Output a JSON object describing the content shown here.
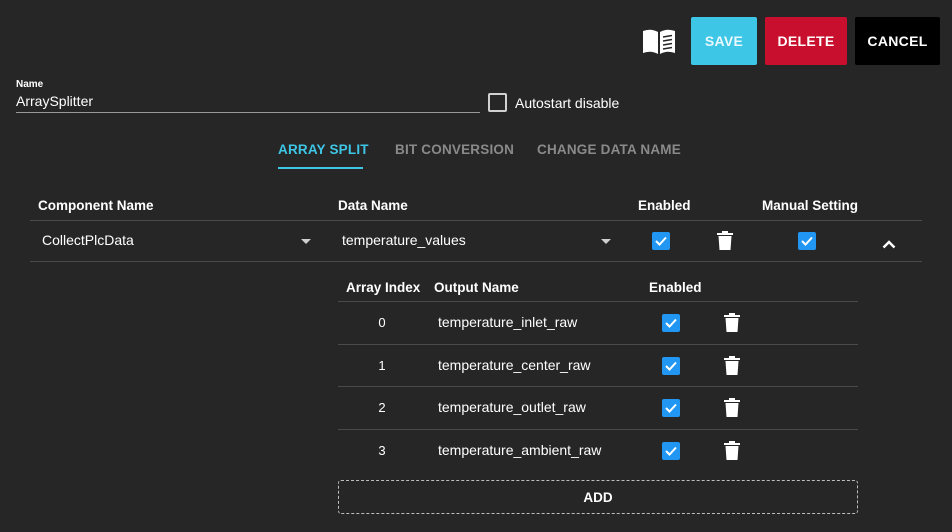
{
  "toolbar": {
    "manual_icon": "book-open-icon",
    "save_label": "SAVE",
    "delete_label": "DELETE",
    "cancel_label": "CANCEL",
    "colors": {
      "save": "#3ec6e6",
      "delete": "#c8102e",
      "cancel": "#000000"
    }
  },
  "name_field": {
    "label": "Name",
    "value": "ArraySplitter"
  },
  "autostart": {
    "label": "Autostart disable",
    "checked": false
  },
  "tabs": [
    {
      "label": "ARRAY SPLIT",
      "active": true
    },
    {
      "label": "BIT CONVERSION",
      "active": false
    },
    {
      "label": "CHANGE DATA NAME",
      "active": false
    }
  ],
  "main_table": {
    "headers": [
      "Component Name",
      "Data Name",
      "Enabled",
      "Manual Setting"
    ],
    "row": {
      "component_name": "CollectPlcData",
      "data_name": "temperature_values",
      "enabled": true,
      "manual_setting": true
    }
  },
  "sub_table": {
    "headers": [
      "Array Index",
      "Output Name",
      "Enabled"
    ],
    "rows": [
      {
        "index": "0",
        "output_name": "temperature_inlet_raw",
        "enabled": true
      },
      {
        "index": "1",
        "output_name": "temperature_center_raw",
        "enabled": true
      },
      {
        "index": "2",
        "output_name": "temperature_outlet_raw",
        "enabled": true
      },
      {
        "index": "3",
        "output_name": "temperature_ambient_raw",
        "enabled": true
      }
    ],
    "add_label": "ADD"
  },
  "accent_color": "#3ec6e6",
  "checkbox_color": "#2196f3"
}
